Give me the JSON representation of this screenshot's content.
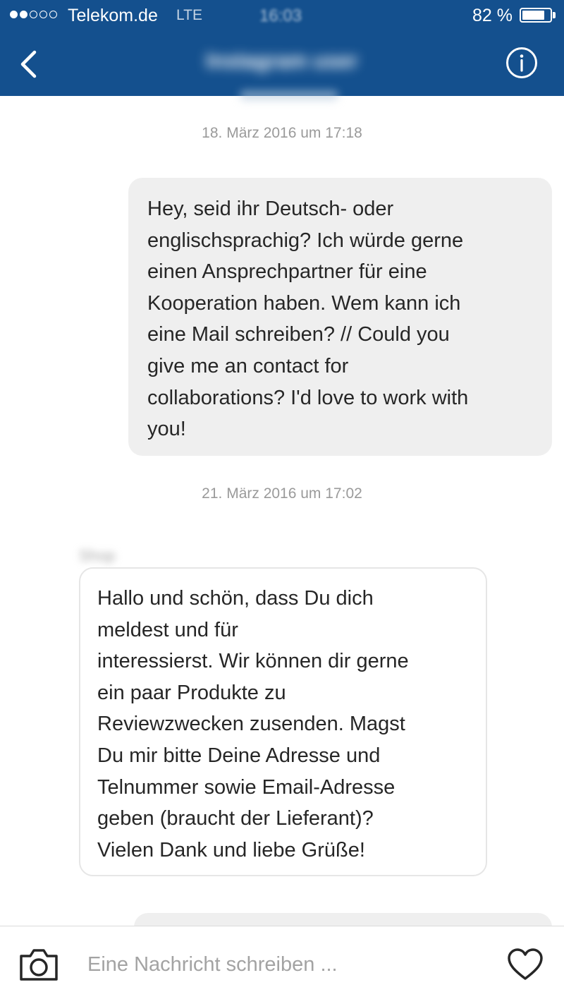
{
  "status_bar": {
    "carrier": "Telekom.de",
    "network": "LTE",
    "time": "16:03",
    "battery_text": "82 %",
    "battery_level": 0.82,
    "signal_bars_filled": 2,
    "signal_bars_total": 5
  },
  "header": {
    "title": "Instagram user",
    "back_icon": "chevron-left-icon",
    "info_icon": "info-circle-icon",
    "background_color": "#14508e"
  },
  "messages": [
    {
      "timestamp": "18. März 2016 um 17:18",
      "direction": "outgoing",
      "lines": [
        "Hey, seid ihr Deutsch- oder",
        "englischsprachig? Ich würde gerne",
        "einen Ansprechpartner für eine",
        "Kooperation haben. Wem kann ich",
        "eine Mail schreiben? // Could you",
        "give me an contact for",
        "collaborations? I'd love to work with",
        "you!"
      ]
    },
    {
      "timestamp": "21. März 2016 um 17:02",
      "direction": "incoming",
      "sender": "Shop",
      "lines": [
        "Hallo und schön, dass Du dich",
        "meldest und für",
        "interessierst. Wir können dir gerne",
        "ein paar Produkte zu",
        "Reviewzwecken zusenden. Magst",
        "Du mir bitte Deine Adresse und",
        "Telnummer sowie Email-Adresse",
        "geben (braucht der Lieferant)?",
        "Vielen Dank und liebe Grüße!"
      ]
    }
  ],
  "composer": {
    "placeholder": "Eine Nachricht schreiben ...",
    "value": "",
    "camera_icon": "camera-icon",
    "like_icon": "heart-icon"
  },
  "colors": {
    "accent": "#14508e",
    "outgoing_bubble": "#efefef",
    "incoming_border": "#e6e6e6",
    "timestamp_text": "#9a9a9a"
  }
}
